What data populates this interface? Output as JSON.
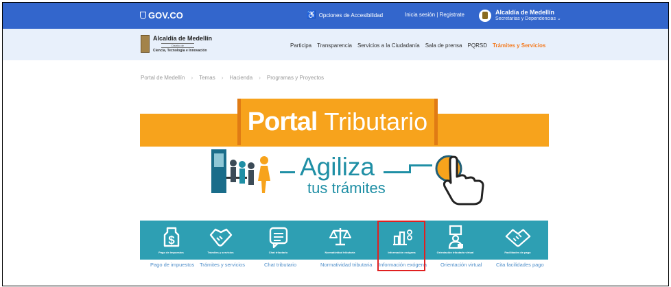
{
  "gov_bar": {
    "logo_text": "GOV.CO",
    "accessibility_label": "Opciones de Accesibilidad",
    "login_label": "Inicia sesión  |  Registrate",
    "alcaldia_title": "Alcaldía de Medellín",
    "alcaldia_subtitle": "Secretarías y Dependencias"
  },
  "nav": {
    "brand_title": "Alcaldía de Medellín",
    "brand_distrito": "Distrito de",
    "brand_subtitle": "Ciencia, Tecnología e Innovación",
    "menu": [
      {
        "label": "Participa"
      },
      {
        "label": "Transparencia"
      },
      {
        "label": "Servicios a la Ciudadanía"
      },
      {
        "label": "Sala de prensa"
      },
      {
        "label": "PQRSD"
      },
      {
        "label": "Trámites y Servicios",
        "active": true
      }
    ]
  },
  "breadcrumb": [
    "Portal de Medellín",
    "Temas",
    "Hacienda",
    "Programas y Proyectos"
  ],
  "banner": {
    "title_bold": "Portal",
    "title_light": "Tributario",
    "headline": "Agiliza",
    "subline": "tus trámites"
  },
  "services": [
    {
      "icon": "dollar-icon",
      "small_label": "Pago de impuestos",
      "link": "Pago de impuestos"
    },
    {
      "icon": "handshake-icon",
      "small_label": "Trámites y servicios",
      "link": "Trámites y servicios"
    },
    {
      "icon": "chat-icon",
      "small_label": "Chat tributario",
      "link": "Chat tributario"
    },
    {
      "icon": "scales-icon",
      "small_label": "Normatividad tributaria",
      "link": "Normatividad tributaria"
    },
    {
      "icon": "bar-chart-icon",
      "small_label": "Información exógena",
      "link": "Información exógena"
    },
    {
      "icon": "virtual-guide-icon",
      "small_label": "Orientación tributaria virtual",
      "link": "Orientación virtual"
    },
    {
      "icon": "agreement-icon",
      "small_label": "Facilidades de pago",
      "link": "Cita facilidades pago"
    }
  ],
  "colors": {
    "gov_blue": "#3366cc",
    "nav_bg": "#e8f0fb",
    "banner_orange": "#f7a31c",
    "teal": "#2e9fb3",
    "active_menu": "#f47b20",
    "highlight": "#e02020"
  }
}
